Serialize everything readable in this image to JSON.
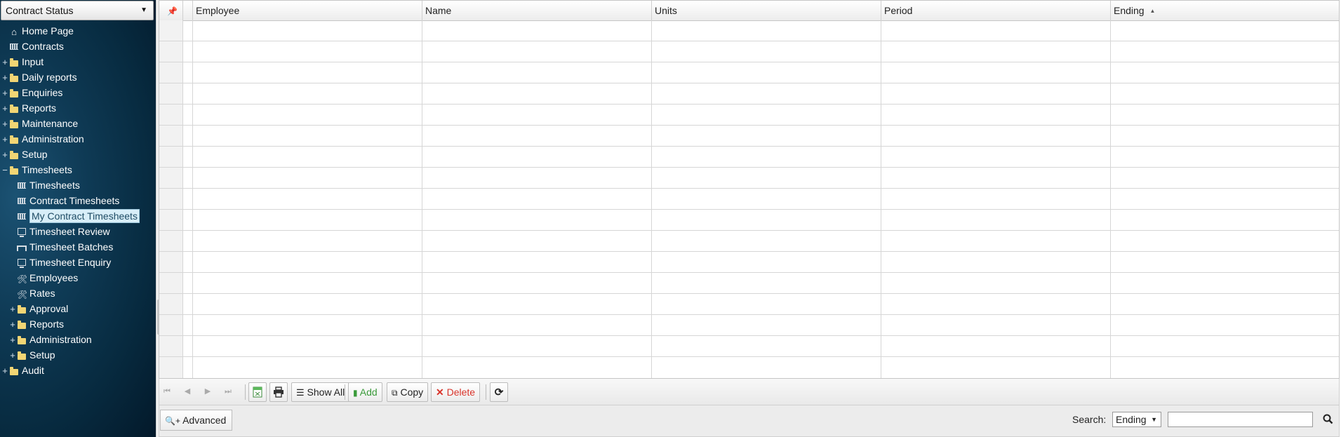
{
  "sidebar": {
    "combo_value": "Contract Status",
    "items": [
      {
        "label": "Home Page",
        "icon": "home-icon",
        "expander": ""
      },
      {
        "label": "Contracts",
        "icon": "grid-icon",
        "expander": ""
      },
      {
        "label": "Input",
        "icon": "folder-icon",
        "expander": "+"
      },
      {
        "label": "Daily reports",
        "icon": "folder-icon",
        "expander": "+"
      },
      {
        "label": "Enquiries",
        "icon": "folder-icon",
        "expander": "+"
      },
      {
        "label": "Reports",
        "icon": "folder-icon",
        "expander": "+"
      },
      {
        "label": "Maintenance",
        "icon": "folder-icon",
        "expander": "+"
      },
      {
        "label": "Administration",
        "icon": "folder-icon",
        "expander": "+"
      },
      {
        "label": "Setup",
        "icon": "folder-icon",
        "expander": "+"
      },
      {
        "label": "Timesheets",
        "icon": "folder-icon",
        "expander": "−"
      },
      {
        "label": "Timesheets",
        "icon": "grid-icon",
        "expander": ""
      },
      {
        "label": "Contract Timesheets",
        "icon": "grid-icon",
        "expander": ""
      },
      {
        "label": "My Contract Timesheets",
        "icon": "grid-icon",
        "expander": "",
        "selected": true
      },
      {
        "label": "Timesheet Review",
        "icon": "monitor-icon",
        "expander": ""
      },
      {
        "label": "Timesheet Batches",
        "icon": "batch-icon",
        "expander": ""
      },
      {
        "label": "Timesheet Enquiry",
        "icon": "monitor-icon",
        "expander": ""
      },
      {
        "label": "Employees",
        "icon": "tools-icon",
        "expander": ""
      },
      {
        "label": "Rates",
        "icon": "tools-icon",
        "expander": ""
      },
      {
        "label": "Approval",
        "icon": "folder-icon",
        "expander": "+"
      },
      {
        "label": "Reports",
        "icon": "folder-icon",
        "expander": "+"
      },
      {
        "label": "Administration",
        "icon": "folder-icon",
        "expander": "+"
      },
      {
        "label": "Setup",
        "icon": "folder-icon",
        "expander": "+"
      },
      {
        "label": "Audit",
        "icon": "folder-icon",
        "expander": "+"
      }
    ]
  },
  "grid": {
    "columns": [
      {
        "label": "Employee",
        "sort": ""
      },
      {
        "label": "Name",
        "sort": ""
      },
      {
        "label": "Units",
        "sort": ""
      },
      {
        "label": "Period",
        "sort": ""
      },
      {
        "label": "Ending",
        "sort": "ascending"
      }
    ],
    "rows": []
  },
  "pager": {
    "show_all_label": "Show All",
    "add_label": "Add",
    "copy_label": "Copy",
    "delete_label": "Delete"
  },
  "searchbar": {
    "advanced_label": "Advanced",
    "search_label": "Search:",
    "search_field_value": "Ending",
    "search_text": ""
  },
  "colors": {
    "sidebar_bg": "#0f3b56",
    "add_color": "#3a9a3a",
    "delete_color": "#d9342b",
    "selected_item_bg": "#d8eef8"
  }
}
